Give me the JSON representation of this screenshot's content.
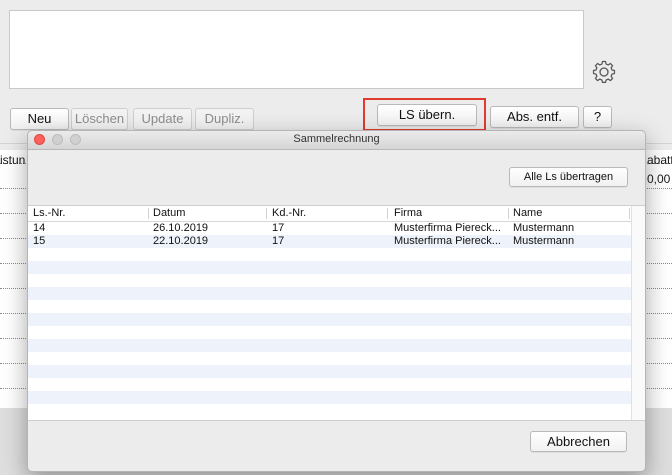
{
  "toolbar": {
    "neu": "Neu",
    "loeschen": "Löschen",
    "update": "Update",
    "dupliz": "Dupliz.",
    "ls_uebern": "LS übern.",
    "abs_entf": "Abs. entf.",
    "help": "?"
  },
  "bg_table": {
    "col_left": "istun",
    "col_right": "abatt",
    "cell_right": "0,00"
  },
  "dialog": {
    "title": "Sammelrechnung",
    "transfer_all": "Alle Ls übertragen",
    "cancel": "Abbrechen",
    "columns": [
      "Ls.-Nr.",
      "Datum",
      "Kd.-Nr.",
      "Firma",
      "Name"
    ],
    "rows": [
      [
        "14",
        "26.10.2019",
        "17",
        "Musterfirma Piereck...",
        "Mustermann"
      ],
      [
        "15",
        "22.10.2019",
        "17",
        "Musterfirma Piereck...",
        "Mustermann"
      ]
    ]
  },
  "icons": {
    "settings": "gear-icon"
  },
  "colors": {
    "focus": "#e23a2f",
    "close": "#fc605b",
    "alt_row": "#eef3fb"
  }
}
